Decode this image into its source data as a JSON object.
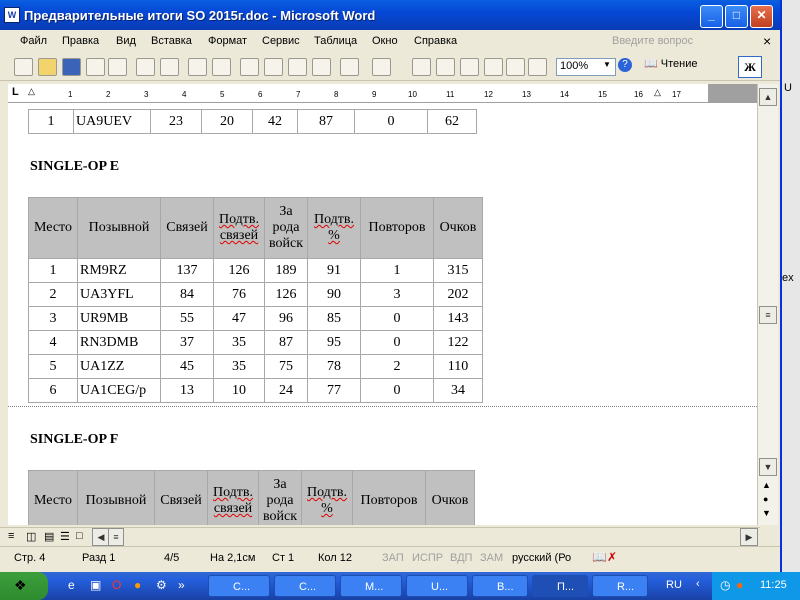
{
  "window": {
    "title": "Предварительные итоги SO 2015г.doc - Microsoft Word",
    "icon": "word-doc-icon"
  },
  "menu": [
    "Файл",
    "Правка",
    "Вид",
    "Вставка",
    "Формат",
    "Сервис",
    "Таблица",
    "Окно",
    "Справка"
  ],
  "help_search": {
    "placeholder": "Введите вопрос"
  },
  "toolbar": {
    "zoom": "100%",
    "reading_label": "Чтение",
    "bold_label": "Ж"
  },
  "ruler_marks": [
    "1",
    "2",
    "3",
    "4",
    "5",
    "6",
    "7",
    "8",
    "9",
    "10",
    "11",
    "12",
    "13",
    "14",
    "15",
    "16",
    "17"
  ],
  "doc": {
    "top_row": [
      "1",
      "UA9UEV",
      "23",
      "20",
      "42",
      "87",
      "0",
      "62"
    ],
    "section_e": "SINGLE-OP E",
    "headers": [
      "Место",
      "Позывной",
      "Связей",
      "Подтв. связей",
      "За рода войск",
      "Подтв. %",
      "Повторов",
      "Очков"
    ],
    "rows": [
      [
        "1",
        "RM9RZ",
        "137",
        "126",
        "189",
        "91",
        "1",
        "315"
      ],
      [
        "2",
        "UA3YFL",
        "84",
        "76",
        "126",
        "90",
        "3",
        "202"
      ],
      [
        "3",
        "UR9MB",
        "55",
        "47",
        "96",
        "85",
        "0",
        "143"
      ],
      [
        "4",
        "RN3DMB",
        "37",
        "35",
        "87",
        "95",
        "0",
        "122"
      ],
      [
        "5",
        "UA1ZZ",
        "45",
        "35",
        "75",
        "78",
        "2",
        "110"
      ],
      [
        "6",
        "UA1CEG/p",
        "13",
        "10",
        "24",
        "77",
        "0",
        "34"
      ]
    ],
    "section_f": "SINGLE-OP F",
    "headers_f": [
      "Место",
      "Позывной",
      "Связей",
      "Подтв. связей",
      "За рода войск",
      "Подтв. %",
      "Повторов",
      "Очков"
    ]
  },
  "status": {
    "page": "Стр. 4",
    "section": "Разд 1",
    "pages": "4/5",
    "at": "На 2,1см",
    "line": "Ст 1",
    "col": "Кол 12",
    "rec": "ЗАП",
    "trk": "ИСПР",
    "ext": "ВДП",
    "ovr": "ЗАМ",
    "lang": "русский (Ро"
  },
  "taskbar": {
    "items": [
      "С...",
      "С...",
      "М...",
      "U...",
      "В...",
      "П...",
      "R..."
    ],
    "lang": "RU",
    "time": "11:25"
  },
  "desk_strip": [
    "U",
    "ex"
  ]
}
